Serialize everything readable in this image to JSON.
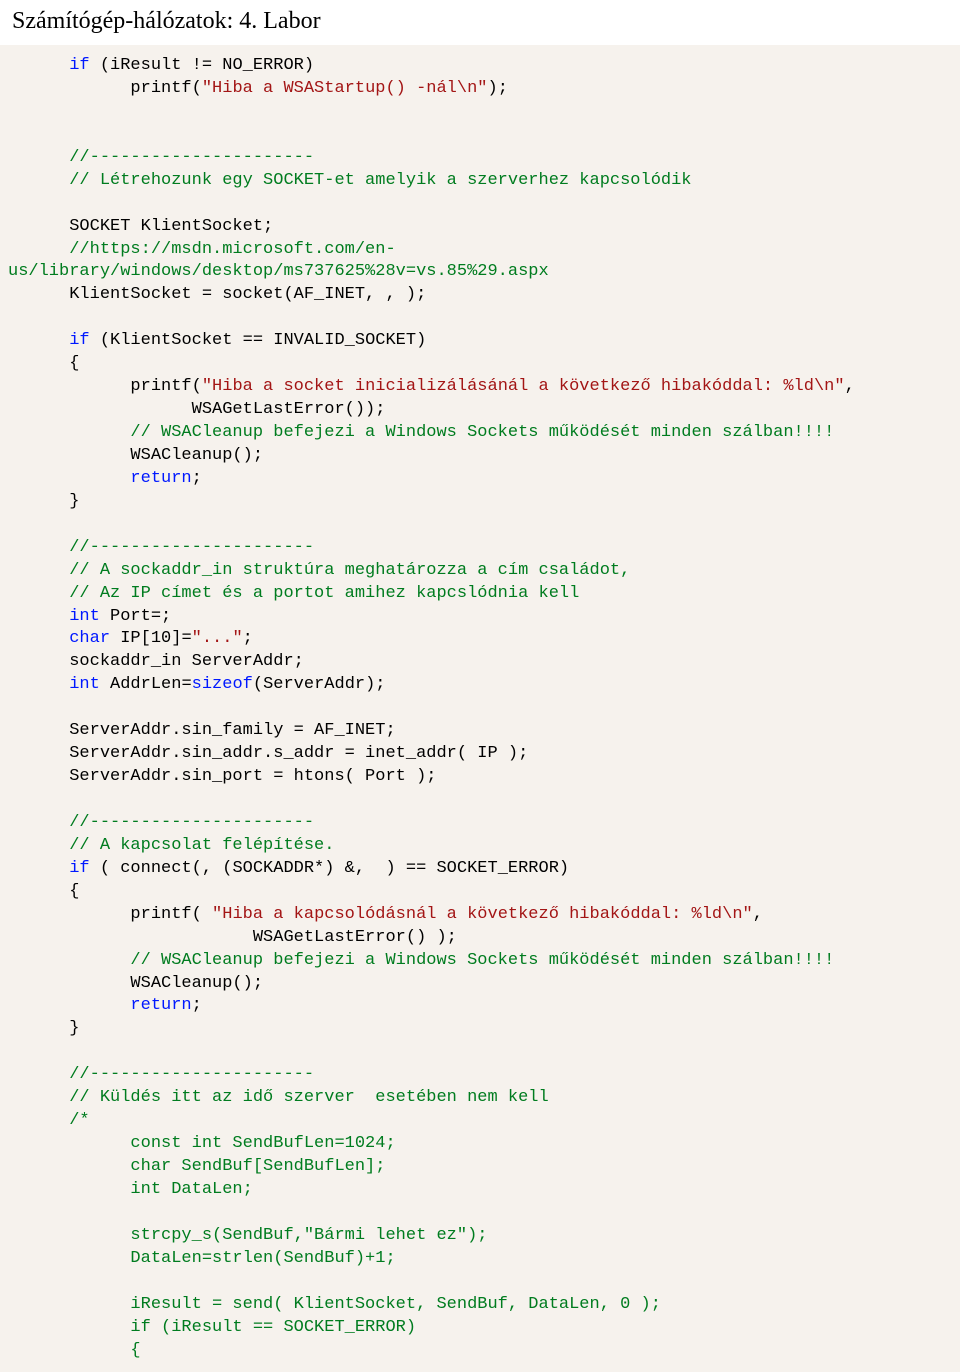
{
  "header": {
    "title": "Számítógép-hálózatok: 4. Labor"
  },
  "code": {
    "kw_if": "if",
    "iresult_neq": " (iResult != NO_ERROR)",
    "printf1_open": "            printf(",
    "printf1_str": "\"Hiba a WSAStartup() -nál\\n\"",
    "printf1_close": ");",
    "sep1": "      //----------------------",
    "cmt1": "      // Létrehozunk egy SOCKET-et amelyik a szerverhez kapcsolódik",
    "sock_decl": "      SOCKET KlientSocket;",
    "cmt2a": "      //https://msdn.microsoft.com/en-",
    "cmt2b": "us/library/windows/desktop/ms737625%28v=vs.85%29.aspx",
    "sock_assign": "      KlientSocket = socket(AF_INET, , );",
    "if_invalid": " (KlientSocket == INVALID_SOCKET)",
    "lbrace": "      {",
    "printf2_open": "            printf(",
    "printf2_str": "\"Hiba a socket inicializálásánál a következő hibakóddal: %ld\\n\"",
    "printf2_close": ",",
    "wsagle": "                  WSAGetLastError());",
    "cmt3": "            // WSACleanup befejezi a Windows Sockets működését minden szálban!!!!",
    "wsacleanup": "            WSACleanup();",
    "kw_return": "return",
    "return_close": ";",
    "rbrace": "      }",
    "sep2": "      //----------------------",
    "cmt4": "      // A sockaddr_in struktúra meghatározza a cím családot,",
    "cmt5": "      // Az IP címet és a portot amihez kapcslódnia kell",
    "kw_int": "int",
    "port_decl": " Port=;",
    "kw_char": "char",
    "ip_decl1": " IP[10]=",
    "ip_str": "\"...\"",
    "ip_decl2": ";",
    "serveraddr_decl": "      sockaddr_in ServerAddr;",
    "addrlen_decl1": " AddrLen=",
    "kw_sizeof": "sizeof",
    "addrlen_decl2": "(ServerAddr);",
    "sin_family": "      ServerAddr.sin_family = AF_INET;",
    "sin_addr": "      ServerAddr.sin_addr.s_addr = inet_addr( IP );",
    "sin_port": "      ServerAddr.sin_port = htons( Port );",
    "sep3": "      //----------------------",
    "cmt6": "      // A kapcsolat felépítése.",
    "connect_open": " ( connect(, (SOCKADDR*) &,  ) == SOCKET_ERROR)",
    "printf3_open": "            printf( ",
    "printf3_str": "\"Hiba a kapcsolódásnál a következő hibakóddal: %ld\\n\"",
    "printf3_close": ",",
    "wsagle2": "                        WSAGetLastError() );",
    "cmt7": "            // WSACleanup befejezi a Windows Sockets működését minden szálban!!!!",
    "sep4": "      //----------------------",
    "cmt8": "      // Küldés itt az idő szerver  esetében nem kell ",
    "cmt9_open": "      /*",
    "cmt9_1": "            const int SendBufLen=1024;",
    "cmt9_2": "            char SendBuf[SendBufLen];",
    "cmt9_3": "            int DataLen;",
    "cmt9_4": "            strcpy_s(SendBuf,\"Bármi lehet ez\");",
    "cmt9_5": "            DataLen=strlen(SendBuf)+1;",
    "cmt9_6": "            iResult = send( KlientSocket, SendBuf, DataLen, 0 );",
    "cmt9_7": "            if (iResult == SOCKET_ERROR)",
    "cmt9_8": "            {"
  }
}
